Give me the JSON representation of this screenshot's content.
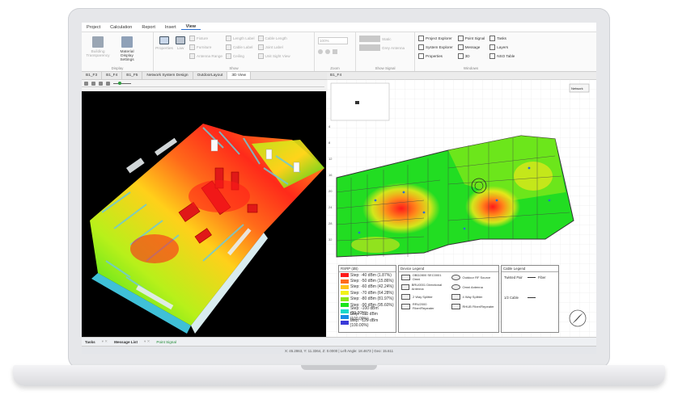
{
  "menu": [
    "Project",
    "Calculation",
    "Report",
    "Insert",
    "View"
  ],
  "menu_active": "View",
  "ribbon": {
    "group1": {
      "items": [
        "Building Transparency",
        "Material Display Settings"
      ],
      "label": "Display"
    },
    "group2": {
      "items": [
        "Properties",
        "Law"
      ],
      "small": [
        "Fixture",
        "Furniture",
        "Antenna Range",
        "Length Label",
        "Cable Label",
        "Cable Length",
        "Ceiling",
        "Joint Label",
        "Unit Sight View"
      ],
      "label": "Show"
    },
    "group3": {
      "zoom": "100%",
      "label": "Zoom"
    },
    "group4": {
      "items": [
        "Static",
        "Grey Antenna"
      ],
      "label": "Show Signal"
    },
    "group5": {
      "items": [
        "Project Explorer",
        "Point Signal",
        "Tasks",
        "System Explorer",
        "Message",
        "Layers",
        "Properties",
        "3D",
        "NSO Table"
      ],
      "label": "Windows"
    }
  },
  "tabs_left": [
    "B1_F3",
    "B1_F4",
    "B1_F5",
    "Network System Design",
    "OutdoorLayout",
    "3D View"
  ],
  "tabs_right": [
    "B1_F4"
  ],
  "legend_signal": {
    "title": "RSRP (dB)",
    "rows": [
      {
        "label": "Step: -40 dBm (1.87%)",
        "color": "#ff1a1a"
      },
      {
        "label": "Step: -50 dBm (15.86%)",
        "color": "#ff6a1a"
      },
      {
        "label": "Step: -60 dBm (42.24%)",
        "color": "#ffc21a"
      },
      {
        "label": "Step: -70 dBm (64.28%)",
        "color": "#f2f21a"
      },
      {
        "label": "Step: -80 dBm (81.97%)",
        "color": "#8ee61a"
      },
      {
        "label": "Step: -90 dBm (95.60%)",
        "color": "#1ae61a"
      },
      {
        "label": "Step: -100 dBm (99.20%)",
        "color": "#1ad8c8"
      },
      {
        "label": "Step: -110 dBm (100.00%)",
        "color": "#1a8ce6"
      },
      {
        "label": "Step: -120 dBm (100.00%)",
        "color": "#3a3ad8"
      }
    ]
  },
  "legend_device": {
    "title": "Device Legend",
    "rows": [
      "OBD2800 SEC0001 Omni",
      "Outdoor RF Source",
      "BRU0001 Directional Antenna",
      "Omni Antenna",
      "2 Way Splitter",
      "4 Way Splitter",
      "RRU2000 Fiber/Repeater",
      "RHUB Fiber/Repeater"
    ]
  },
  "legend_cable": {
    "title": "Cable Legend",
    "rows": [
      "Twisted Pair",
      "Fiber",
      "1/2 Cable"
    ]
  },
  "statusbar": [
    "Tasks",
    "Message List",
    "Point Signal"
  ],
  "coords": "X: 45.2863, Y: 11.3364, Z: 0.0000 | Left Angle: 18.4673 | Geo: 15.611"
}
